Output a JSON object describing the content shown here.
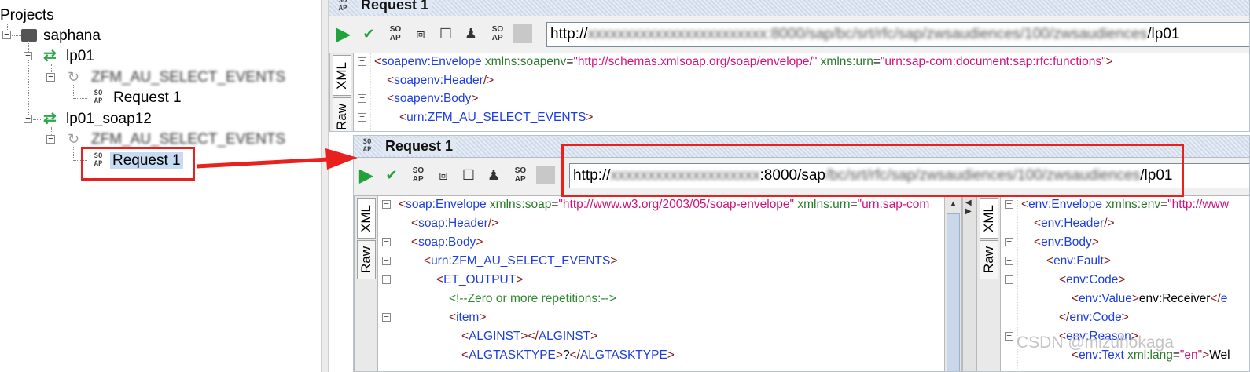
{
  "tree": {
    "root_label": "Projects",
    "project": "saphana",
    "interface1": "lp01",
    "operation1": "ZFM_AU_SELECT_EVENTS",
    "request1": "Request 1",
    "interface2": "lp01_soap12",
    "operation2": "ZFM_AU_SELECT_EVENTS",
    "request2": "Request 1",
    "soap_icon_top": "SO",
    "soap_icon_bottom": "AP"
  },
  "back_window": {
    "title": "Request 1",
    "url_prefix": "http://",
    "url_blurred": "xxxxxxxxxxxxxxxxxxxxxxxx:8000/sap/bc/srt/rfc/sap/zwsaudiences/100/zwsaudiences",
    "url_suffix": "/lp01",
    "tabs": {
      "xml": "XML",
      "raw": "Raw"
    },
    "lines": [
      {
        "indent": 0,
        "fold": "−",
        "parts": [
          [
            "tag",
            "<"
          ],
          [
            "ns",
            "soapenv:Envelope"
          ],
          [
            "attr",
            " xmlns:soapenv"
          ],
          [
            "txt",
            "="
          ],
          [
            "str",
            "\"http://schemas.xmlsoap.org/soap/envelope/\""
          ],
          [
            "attr",
            " xmlns:urn"
          ],
          [
            "txt",
            "="
          ],
          [
            "str",
            "\"urn:sap-com:document:sap:rfc:functions\""
          ],
          [
            "tag",
            ">"
          ]
        ]
      },
      {
        "indent": 1,
        "fold": "",
        "parts": [
          [
            "tag",
            "<"
          ],
          [
            "ns",
            "soapenv:Header"
          ],
          [
            "tag",
            "/>"
          ]
        ]
      },
      {
        "indent": 1,
        "fold": "−",
        "parts": [
          [
            "tag",
            "<"
          ],
          [
            "ns",
            "soapenv:Body"
          ],
          [
            "tag",
            ">"
          ]
        ]
      },
      {
        "indent": 2,
        "fold": "−",
        "parts": [
          [
            "tag",
            "<"
          ],
          [
            "ns",
            "urn:ZFM_AU_SELECT_EVENTS"
          ],
          [
            "tag",
            ">"
          ]
        ]
      }
    ]
  },
  "front_window": {
    "title": "Request 1",
    "url_prefix": "http://",
    "url_blurred": "xxxxxxxxxxxxxxxxxxxx",
    "url_mid": ":8000/sap",
    "url_blurred2": "/bc/srt/rfc/sap/zwsaudiences/100/zwsaudiences",
    "url_suffix": "/lp01",
    "tabs": {
      "xml": "XML",
      "raw": "Raw"
    },
    "request_lines": [
      {
        "indent": 0,
        "fold": "−",
        "parts": [
          [
            "tag",
            "<"
          ],
          [
            "ns",
            "soap:Envelope"
          ],
          [
            "attr",
            " xmlns:soap"
          ],
          [
            "txt",
            "="
          ],
          [
            "str",
            "\"http://www.w3.org/2003/05/soap-envelope\""
          ],
          [
            "attr",
            " xmlns:urn"
          ],
          [
            "txt",
            "="
          ],
          [
            "str",
            "\"urn:sap-com"
          ]
        ]
      },
      {
        "indent": 1,
        "fold": "",
        "parts": [
          [
            "tag",
            "<"
          ],
          [
            "ns",
            "soap:Header"
          ],
          [
            "tag",
            "/>"
          ]
        ]
      },
      {
        "indent": 1,
        "fold": "−",
        "parts": [
          [
            "tag",
            "<"
          ],
          [
            "ns",
            "soap:Body"
          ],
          [
            "tag",
            ">"
          ]
        ]
      },
      {
        "indent": 2,
        "fold": "−",
        "parts": [
          [
            "tag",
            "<"
          ],
          [
            "ns",
            "urn:ZFM_AU_SELECT_EVENTS"
          ],
          [
            "tag",
            ">"
          ]
        ]
      },
      {
        "indent": 3,
        "fold": "−",
        "parts": [
          [
            "tag",
            "<"
          ],
          [
            "ns",
            "ET_OUTPUT"
          ],
          [
            "tag",
            ">"
          ]
        ]
      },
      {
        "indent": 4,
        "fold": "",
        "parts": [
          [
            "cmt",
            "<!--Zero or more repetitions:-->"
          ]
        ]
      },
      {
        "indent": 4,
        "fold": "−",
        "parts": [
          [
            "tag",
            "<"
          ],
          [
            "ns",
            "item"
          ],
          [
            "tag",
            ">"
          ]
        ]
      },
      {
        "indent": 5,
        "fold": "",
        "parts": [
          [
            "tag",
            "<"
          ],
          [
            "ns",
            "ALGINST"
          ],
          [
            "tag",
            "></"
          ],
          [
            "ns",
            "ALGINST"
          ],
          [
            "tag",
            ">"
          ]
        ]
      },
      {
        "indent": 5,
        "fold": "",
        "parts": [
          [
            "tag",
            "<"
          ],
          [
            "ns",
            "ALGTASKTYPE"
          ],
          [
            "tag",
            ">"
          ],
          [
            "txt",
            "?"
          ],
          [
            "tag",
            "</"
          ],
          [
            "ns",
            "ALGTASKTYPE"
          ],
          [
            "tag",
            ">"
          ]
        ]
      }
    ],
    "response_lines": [
      {
        "indent": 0,
        "fold": "−",
        "parts": [
          [
            "tag",
            "<"
          ],
          [
            "ns",
            "env:Envelope"
          ],
          [
            "attr",
            " xmlns:env"
          ],
          [
            "txt",
            "="
          ],
          [
            "str",
            "\"http://www"
          ]
        ]
      },
      {
        "indent": 1,
        "fold": "",
        "parts": [
          [
            "tag",
            "<"
          ],
          [
            "ns",
            "env:Header"
          ],
          [
            "tag",
            "/>"
          ]
        ]
      },
      {
        "indent": 1,
        "fold": "−",
        "parts": [
          [
            "tag",
            "<"
          ],
          [
            "ns",
            "env:Body"
          ],
          [
            "tag",
            ">"
          ]
        ]
      },
      {
        "indent": 2,
        "fold": "−",
        "parts": [
          [
            "tag",
            "<"
          ],
          [
            "ns",
            "env:Fault"
          ],
          [
            "tag",
            ">"
          ]
        ]
      },
      {
        "indent": 3,
        "fold": "−",
        "parts": [
          [
            "tag",
            "<"
          ],
          [
            "ns",
            "env:Code"
          ],
          [
            "tag",
            ">"
          ]
        ]
      },
      {
        "indent": 4,
        "fold": "",
        "parts": [
          [
            "tag",
            "<"
          ],
          [
            "ns",
            "env:Value"
          ],
          [
            "tag",
            ">"
          ],
          [
            "txt",
            "env:Receiver"
          ],
          [
            "tag",
            "</"
          ],
          [
            "ns",
            "e"
          ]
        ]
      },
      {
        "indent": 3,
        "fold": "",
        "parts": [
          [
            "tag",
            "</"
          ],
          [
            "ns",
            "env:Code"
          ],
          [
            "tag",
            ">"
          ]
        ]
      },
      {
        "indent": 3,
        "fold": "−",
        "parts": [
          [
            "tag",
            "<"
          ],
          [
            "ns",
            "env:Reason"
          ],
          [
            "tag",
            ">"
          ]
        ]
      },
      {
        "indent": 4,
        "fold": "",
        "parts": [
          [
            "tag",
            "<"
          ],
          [
            "ns",
            "env:Text"
          ],
          [
            "attr",
            " xml:lang"
          ],
          [
            "txt",
            "="
          ],
          [
            "str",
            "\"en\""
          ],
          [
            "tag",
            ">"
          ],
          [
            "txt",
            "Wel"
          ]
        ]
      }
    ]
  },
  "watermark": "CSDN @mizuhokaga",
  "colors": {
    "annotation_red": "#e8201e",
    "selection": "#c7dcf3",
    "run_green": "#22a33a"
  }
}
